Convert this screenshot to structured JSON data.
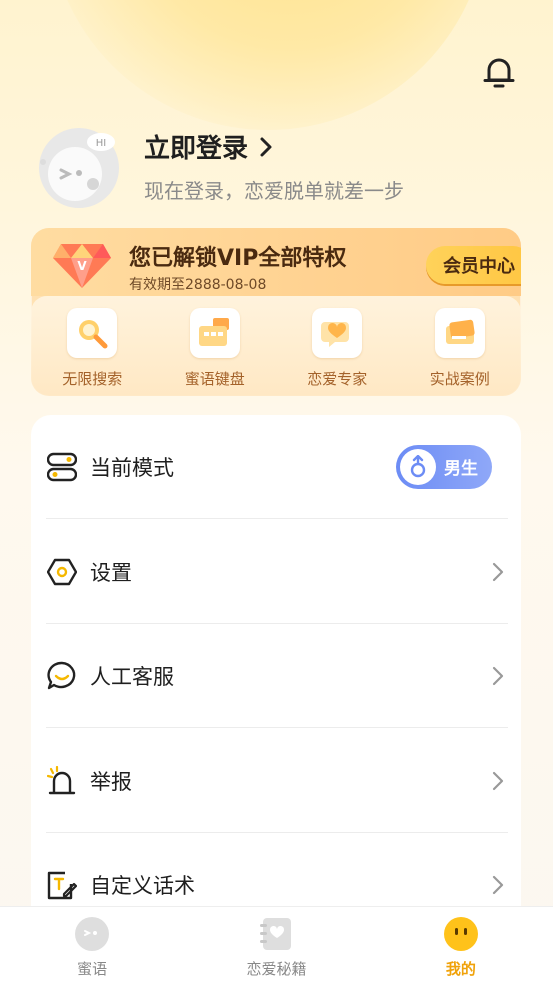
{
  "header": {
    "login_title": "立即登录",
    "login_subtitle": "现在登录，恋爱脱单就差一步",
    "avatar_badge": "HI"
  },
  "vip": {
    "title": "您已解锁VIP全部特权",
    "expire": "有效期至2888-08-08",
    "member_center": "会员中心",
    "perks": [
      {
        "label": "无限搜索",
        "icon": "search-icon"
      },
      {
        "label": "蜜语键盘",
        "icon": "keyboard-icon"
      },
      {
        "label": "恋爱专家",
        "icon": "heart-chat-icon"
      },
      {
        "label": "实战案例",
        "icon": "case-card-icon"
      }
    ]
  },
  "settings": {
    "mode_label": "当前模式",
    "gender_value": "男生",
    "items": [
      {
        "label": "设置",
        "icon": "settings-icon"
      },
      {
        "label": "人工客服",
        "icon": "customer-service-icon"
      },
      {
        "label": "举报",
        "icon": "report-icon"
      },
      {
        "label": "自定义话术",
        "icon": "custom-script-icon"
      }
    ]
  },
  "tabbar": {
    "tabs": [
      {
        "label": "蜜语",
        "active": false
      },
      {
        "label": "恋爱秘籍",
        "active": false
      },
      {
        "label": "我的",
        "active": true
      }
    ]
  },
  "colors": {
    "accent": "#f0a20a",
    "gender_toggle": "#7b98f6",
    "vip_text": "#4a2a10",
    "perk_label": "#a4622a"
  }
}
